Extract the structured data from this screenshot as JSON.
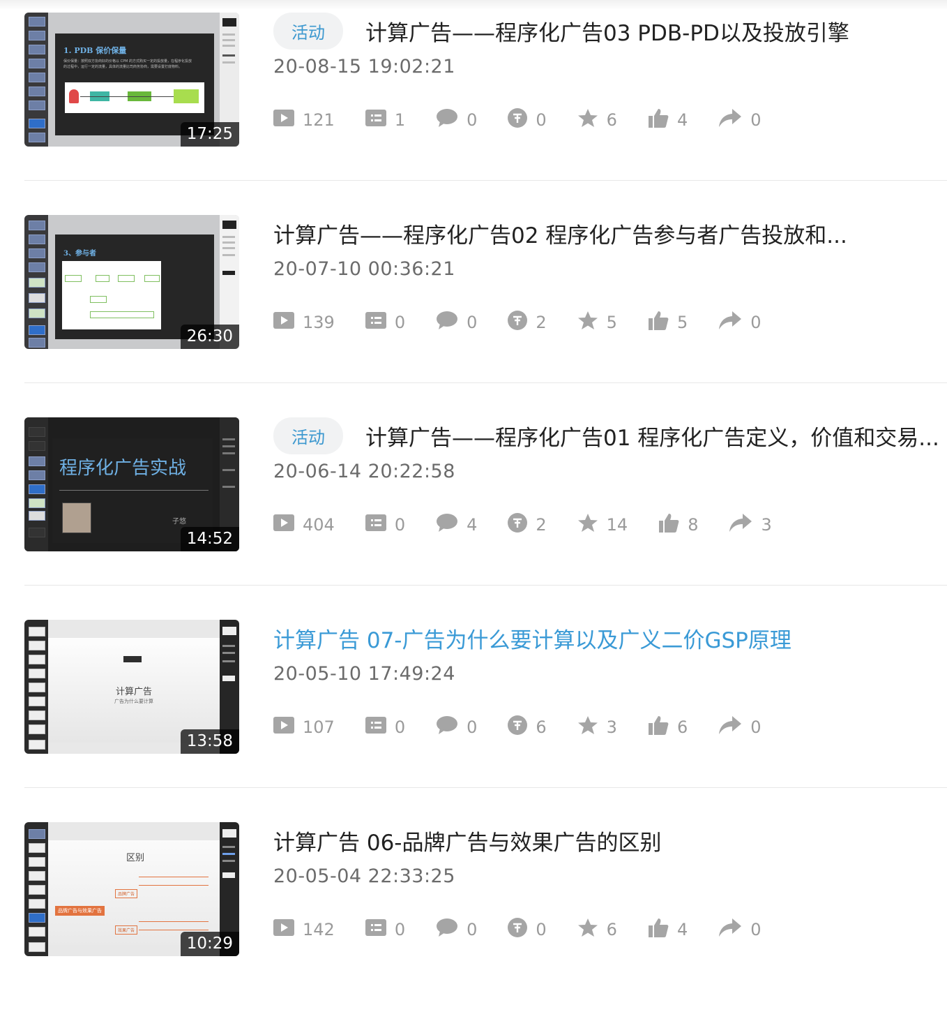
{
  "videos": [
    {
      "badge": "活动",
      "title": "计算广告——程序化广告03 PDB-PD以及投放引擎",
      "date": "20-08-15 19:02:21",
      "duration": "17:25",
      "thumb": {
        "heading": "1. PDB 保价保量",
        "body1": "保价保量：按照双方协商好的价格以 CPM 的方式购买一定的投放量，在程序化投放",
        "body2": "的过程中，运行一定的流量，具体的流量比司商务协商，需要设置打底物料。"
      },
      "stats": {
        "plays": "121",
        "danmaku": "1",
        "comments": "0",
        "coins": "0",
        "favorites": "6",
        "likes": "4",
        "shares": "0"
      }
    },
    {
      "badge": "",
      "title": "计算广告——程序化广告02 程序化广告参与者广告投放和...",
      "date": "20-07-10 00:36:21",
      "duration": "26:30",
      "thumb": {
        "heading": "3、参与者",
        "body1": "",
        "body2": ""
      },
      "stats": {
        "plays": "139",
        "danmaku": "0",
        "comments": "0",
        "coins": "2",
        "favorites": "5",
        "likes": "5",
        "shares": "0"
      }
    },
    {
      "badge": "活动",
      "title": "计算广告——程序化广告01 程序化广告定义，价值和交易...",
      "date": "20-06-14 20:22:58",
      "duration": "14:52",
      "thumb": {
        "heading": "程序化广告实战",
        "body1": "子悠",
        "body2": ""
      },
      "stats": {
        "plays": "404",
        "danmaku": "0",
        "comments": "4",
        "coins": "2",
        "favorites": "14",
        "likes": "8",
        "shares": "3"
      }
    },
    {
      "badge": "",
      "title": "计算广告 07-广告为什么要计算以及广义二价GSP原理",
      "date": "20-05-10 17:49:24",
      "duration": "13:58",
      "thumb": {
        "heading": "计算广告",
        "body1": "广告为什么要计算",
        "body2": ""
      },
      "stats": {
        "plays": "107",
        "danmaku": "0",
        "comments": "0",
        "coins": "6",
        "favorites": "3",
        "likes": "6",
        "shares": "0"
      }
    },
    {
      "badge": "",
      "title": "计算广告 06-品牌广告与效果广告的区别",
      "date": "20-05-04 22:33:25",
      "duration": "10:29",
      "thumb": {
        "heading": "区别",
        "body1": "品牌广告与效果广告",
        "body2": "品牌广告",
        "body3": "效果广告"
      },
      "stats": {
        "plays": "142",
        "danmaku": "0",
        "comments": "0",
        "coins": "0",
        "favorites": "6",
        "likes": "4",
        "shares": "0"
      }
    }
  ],
  "colors": {
    "accent": "#3c98cf",
    "hover_title": "#3a9ad6",
    "stat_gray": "#9a9a9a",
    "badge_bg": "#f1f2f3"
  },
  "stat_icons": [
    "play-icon",
    "danmaku-icon",
    "comment-icon",
    "coin-icon",
    "favorite-star-icon",
    "like-thumb-icon",
    "share-arrow-icon"
  ]
}
